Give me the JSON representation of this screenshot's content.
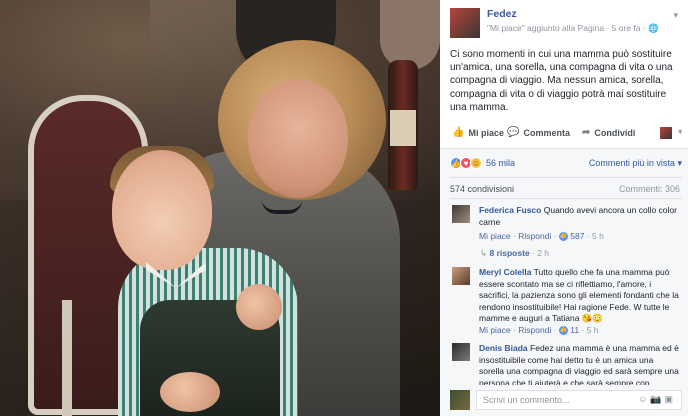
{
  "post": {
    "page_name": "Fedez",
    "subline": "\"Mi piace\" aggiunto alla Pagina · 5 ore fa · ",
    "privacy_icon": "globe-icon",
    "text": "Ci sono momenti in cui una mamma può sostituire un'amica, una sorella, una compagna di vita o una compagna di viaggio. Ma nessun amica, sorella, compagna di vita o di viaggio potrà mai sostituire una mamma.",
    "actions": {
      "like": "Mi piace",
      "comment": "Commenta",
      "share": "Condividi"
    }
  },
  "stats": {
    "reactions_count": "56 mila",
    "relevance_label": "Commenti più in vista",
    "shares": "574 condivisioni",
    "comments": "Commenti: 306"
  },
  "comments": [
    {
      "name": "Federica Fusco",
      "text": "Quando avevi ancora un collo color carne",
      "like_label": "Mi piace",
      "reply_label": "Rispondi",
      "likes": "587",
      "time": "5 h"
    },
    {
      "name": "Meryl Colella",
      "text": "Tutto quello che fa una mamma può essere scontato ma se ci riflettiamo, l'amore, i sacrifici, la pazienza sono gli elementi fondanti che la rendono insostituibile! Hai ragione Fede. W tutte le mamme e auguri a Tatiana 😘😳",
      "like_label": "Mi piace",
      "reply_label": "Rispondi",
      "likes": "11",
      "time": "5 h"
    },
    {
      "name": "Denis Biada",
      "text": "Fedez una mamma è una mamma ed è insostituibile come hai detto tu è un amica una sorella una compagna di viaggio ed sarà sempre una persona che ti aiuterà e che sarà sempre con"
    }
  ],
  "replies": {
    "label": "8 risposte",
    "time": "2 h"
  },
  "composer": {
    "placeholder": "Scrivi un commento..."
  },
  "colors": {
    "link": "#365899",
    "like_blue": "#5890ff",
    "love_red": "#f25268"
  }
}
